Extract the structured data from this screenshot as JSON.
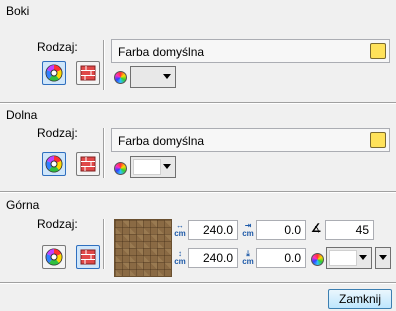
{
  "boki": {
    "title": "Boki",
    "rodzaj_label": "Rodzaj:",
    "paint": "Farba domyślna"
  },
  "dolna": {
    "title": "Dolna",
    "rodzaj_label": "Rodzaj:",
    "paint": "Farba domyślna"
  },
  "gorna": {
    "title": "Górna",
    "rodzaj_label": "Rodzaj:",
    "width": "240.0",
    "height": "240.0",
    "offset_x": "0.0",
    "offset_y": "0.0",
    "angle": "45",
    "unit": "cm"
  },
  "footer": {
    "close_label": "Zamknij"
  },
  "icons": {
    "paint_mode": "color-wheel-icon",
    "texture_mode": "brick-wall-icon",
    "library": "lightbulb-icon",
    "color": "color-wheel-icon"
  }
}
